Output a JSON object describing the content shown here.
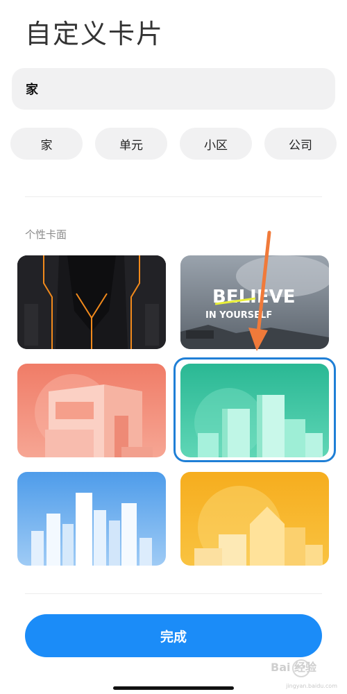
{
  "page": {
    "title": "自定义卡片"
  },
  "name_input": {
    "value": "家"
  },
  "chips": [
    {
      "label": "家"
    },
    {
      "label": "单元"
    },
    {
      "label": "小区"
    },
    {
      "label": "公司"
    }
  ],
  "section": {
    "label": "个性卡面"
  },
  "cards": [
    {
      "theme": "dark-mecha",
      "colors": [
        "#1b1b1d",
        "#f28a1c"
      ]
    },
    {
      "theme": "believe-in-yourself",
      "text_line1": "BELIEVE",
      "text_line2": "IN YOURSELF",
      "colors": [
        "#7d8793",
        "#e9ef3a"
      ]
    },
    {
      "theme": "coral-building",
      "colors": [
        "#f28b78",
        "#fbd0c4"
      ]
    },
    {
      "theme": "teal-city",
      "colors": [
        "#2cbf9a",
        "#a6f1dc"
      ],
      "selected": true
    },
    {
      "theme": "blue-skyline",
      "colors": [
        "#5aa8ec",
        "#e9f4ff"
      ]
    },
    {
      "theme": "orange-village",
      "colors": [
        "#f4a91f",
        "#ffe29a"
      ]
    }
  ],
  "arrow": {
    "color": "#f07a3a"
  },
  "done_button": {
    "label": "完成",
    "color": "#1b8cf8"
  },
  "watermark": {
    "text": "Bai 经验",
    "url": "jingyan.baidu.com"
  }
}
